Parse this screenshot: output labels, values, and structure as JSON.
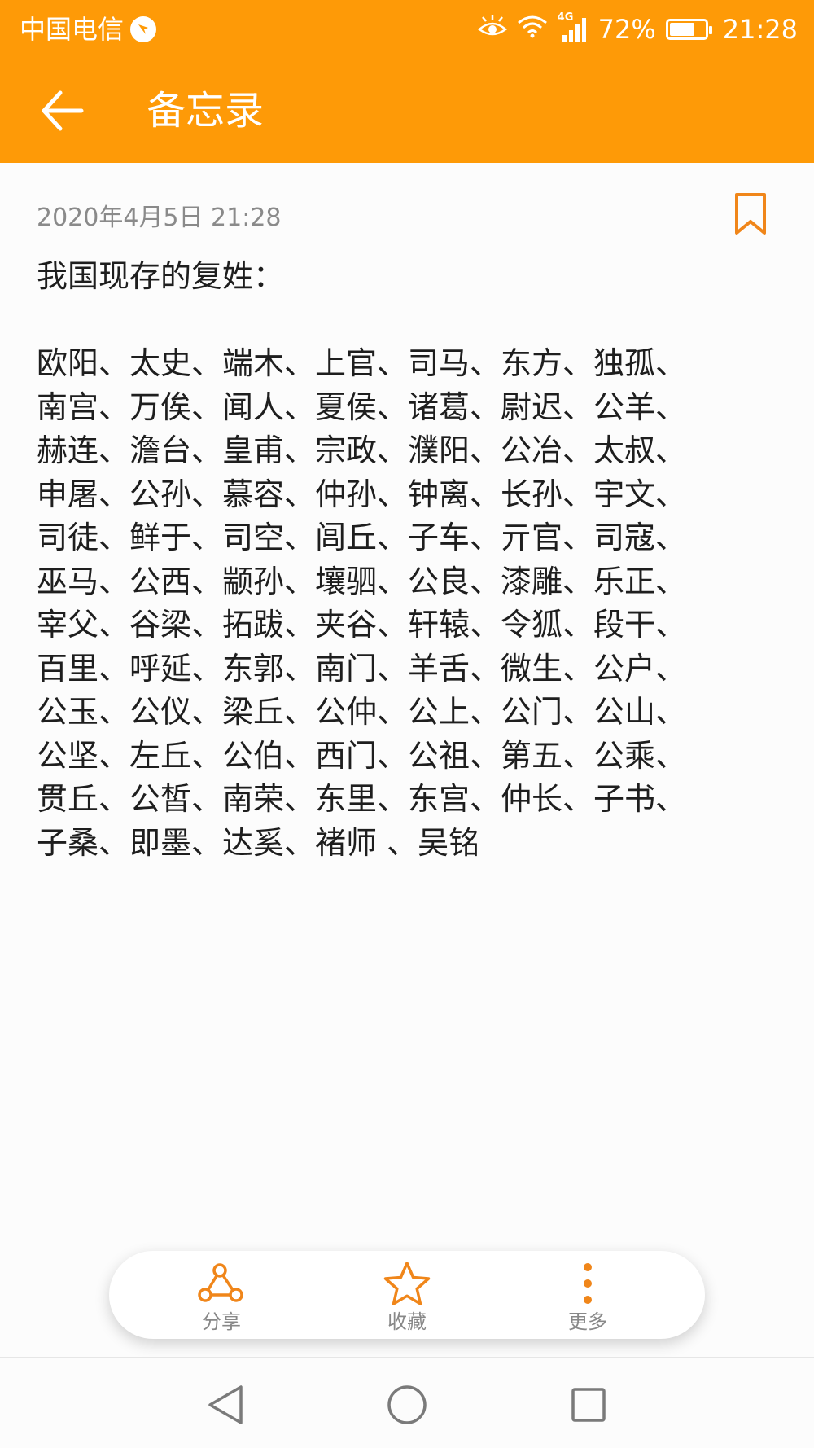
{
  "status_bar": {
    "carrier": "中国电信",
    "battery_percent": "72%",
    "battery_level": 0.72,
    "time": "21:28",
    "network": "4G",
    "icons": [
      "eye-comfort-icon",
      "wifi-icon",
      "signal-icon",
      "battery-icon"
    ]
  },
  "app_bar": {
    "title": "备忘录",
    "back_icon": "arrow-left-icon"
  },
  "note": {
    "date": "2020年4月5日 21:28",
    "title": "我国现存的复姓：",
    "lines": [
      "欧阳、太史、端木、上官、司马、东方、独孤、",
      "南宫、万俟、闻人、夏侯、诸葛、尉迟、公羊、",
      "赫连、澹台、皇甫、宗政、濮阳、公冶、太叔、",
      "申屠、公孙、慕容、仲孙、钟离、长孙、宇文、",
      "司徒、鲜于、司空、闾丘、子车、亓官、司寇、",
      "巫马、公西、颛孙、壤驷、公良、漆雕、乐正、",
      "宰父、谷梁、拓跋、夹谷、轩辕、令狐、段干、",
      "百里、呼延、东郭、南门、羊舌、微生、公户、",
      "公玉、公仪、梁丘、公仲、公上、公门、公山、",
      "公坚、左丘、公伯、西门、公祖、第五、公乘、",
      "贯丘、公皙、南荣、东里、东宫、仲长、子书、",
      "子桑、即墨、达奚、褚师 、吴铭"
    ]
  },
  "actions": {
    "share": "分享",
    "favorite": "收藏",
    "more": "更多"
  },
  "colors": {
    "accent": "#fe9a07",
    "icon_accent": "#f0861a",
    "background": "#fcfcfc",
    "date_text": "#8a8a8a"
  }
}
